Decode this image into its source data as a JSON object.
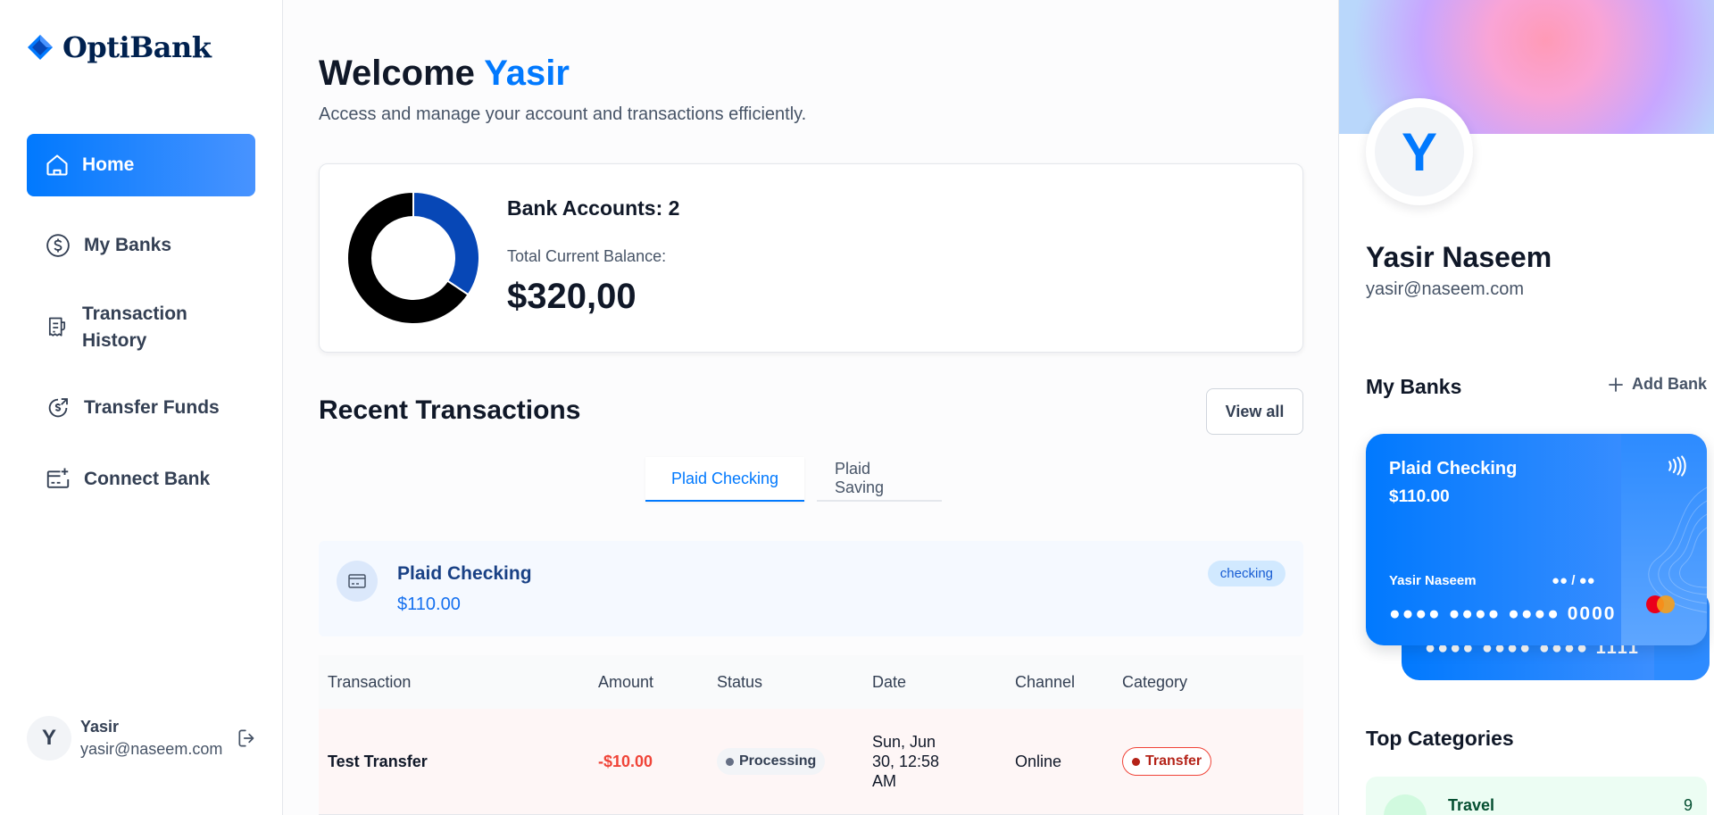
{
  "app": {
    "name": "OptiBank"
  },
  "sidebar": {
    "items": [
      {
        "label": "Home"
      },
      {
        "label": "My Banks"
      },
      {
        "label": "Transaction History"
      },
      {
        "label": "Transfer Funds"
      },
      {
        "label": "Connect Bank"
      }
    ],
    "user": {
      "initial": "Y",
      "name": "Yasir",
      "email": "yasir@naseem.com"
    }
  },
  "header": {
    "welcome_prefix": "Welcome",
    "welcome_name": "Yasir",
    "subtitle": "Access and manage your account and transactions efficiently."
  },
  "balance": {
    "accounts_label": "Bank Accounts: 2",
    "total_label": "Total Current Balance:",
    "total_value": "$320,00"
  },
  "chart_data": {
    "type": "pie",
    "categories": [
      "Plaid Checking",
      "Plaid Saving"
    ],
    "values": [
      110,
      210
    ],
    "colors": [
      "#0747b6",
      "#000000"
    ]
  },
  "recent": {
    "title": "Recent Transactions",
    "view_all": "View all",
    "tabs": [
      {
        "label": "Plaid Checking"
      },
      {
        "label": "Plaid Saving"
      }
    ],
    "account": {
      "name": "Plaid Checking",
      "balance": "$110.00",
      "type": "checking"
    },
    "columns": [
      "Transaction",
      "Amount",
      "Status",
      "Date",
      "Channel",
      "Category"
    ],
    "rows": [
      {
        "name": "Test Transfer",
        "amount": "-$10.00",
        "status": "Processing",
        "date_line1": "Sun, Jun",
        "date_line2": "30, 12:58",
        "date_line3": "AM",
        "channel": "Online",
        "category": "Transfer"
      }
    ]
  },
  "profile": {
    "initial": "Y",
    "name": "Yasir Naseem",
    "email": "yasir@naseem.com"
  },
  "my_banks": {
    "title": "My Banks",
    "add_label": "Add Bank",
    "card_front": {
      "name": "Plaid Checking",
      "balance": "$110.00",
      "holder": "Yasir Naseem",
      "expiry": "●● / ●●",
      "number": "●●●● ●●●● ●●●● 0000"
    },
    "card_back": {
      "number": "●●●● ●●●● ●●●● 1111"
    }
  },
  "top_categories": {
    "title": "Top Categories",
    "items": [
      {
        "name": "Travel",
        "count": "9"
      }
    ]
  },
  "colors": {
    "accent": "#0179fe",
    "debit": "#f04438",
    "checking_badge": "#d1e9ff"
  }
}
